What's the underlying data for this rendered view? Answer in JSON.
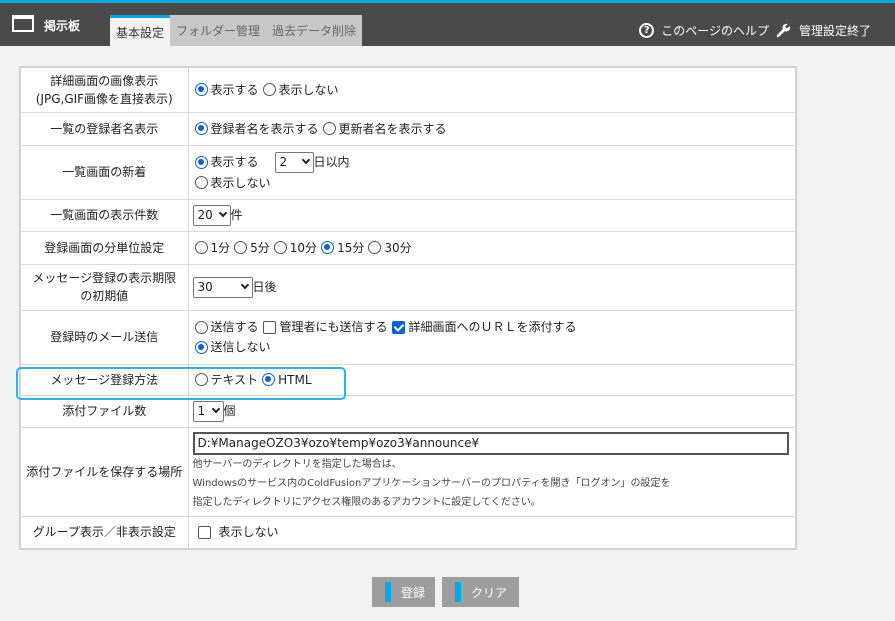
{
  "header": {
    "app_title": "掲示板",
    "app_icon": "board-icon",
    "tabs": [
      {
        "label": "基本設定",
        "active": true
      },
      {
        "label": "フォルダー管理",
        "active": false
      },
      {
        "label": "過去データ削除",
        "active": false
      }
    ],
    "help_label": "このページのヘルプ",
    "help_icon": "help-icon",
    "admin_label": "管理設定終了",
    "admin_icon": "wrench-icon",
    "accent_color": "#0aa7e4"
  },
  "settings": {
    "image_display": {
      "label_line1": "詳細画面の画像表示",
      "label_line2": "(JPG,GIF画像を直接表示)",
      "options": [
        "表示する",
        "表示しない"
      ],
      "selected": 0
    },
    "poster_name": {
      "label": "一覧の登録者名表示",
      "options": [
        "登録者名を表示する",
        "更新者名を表示する"
      ],
      "selected": 0
    },
    "new_mark": {
      "label": "一覧画面の新着",
      "show": "表示する",
      "days_value": "2",
      "days_suffix": "日以内",
      "hide": "表示しない",
      "selected": 0
    },
    "list_count": {
      "label": "一覧画面の表示件数",
      "value": "20",
      "suffix": "件"
    },
    "minute_unit": {
      "label": "登録画面の分単位設定",
      "options": [
        "1分",
        "5分",
        "10分",
        "15分",
        "30分"
      ],
      "selected": 3
    },
    "expiry": {
      "label_line1": "メッセージ登録の表示期限",
      "label_line2": "の初期値",
      "value": "30",
      "suffix": "日後"
    },
    "mail": {
      "label": "登録時のメール送信",
      "send": "送信する",
      "admin_also": "管理者にも送信する",
      "attach_url": "詳細画面へのＵＲＬを添付する",
      "no_send": "送信しない",
      "selected": "no_send",
      "admin_also_checked": false,
      "attach_url_checked": true
    },
    "message_format": {
      "label": "メッセージ登録方法",
      "options": [
        "テキスト",
        "HTML"
      ],
      "selected": 1
    },
    "attach_count": {
      "label": "添付ファイル数",
      "value": "1",
      "suffix": "個"
    },
    "attach_path": {
      "label": "添付ファイルを保存する場所",
      "value": "D:¥ManageOZO3¥ozo¥temp¥ozo3¥announce¥",
      "note1": "他サーバーのディレクトリを指定した場合は、",
      "note2": "Windowsのサービス内のColdFusionアプリケーションサーバーのプロパティを開き「ログオン」の設定を",
      "note3": "指定したディレクトリにアクセス権限のあるアカウントに設定してください。"
    },
    "group_display": {
      "label": "グループ表示／非表示設定",
      "option": "表示しない",
      "checked": false
    }
  },
  "buttons": {
    "register": "登録",
    "clear": "クリア"
  }
}
